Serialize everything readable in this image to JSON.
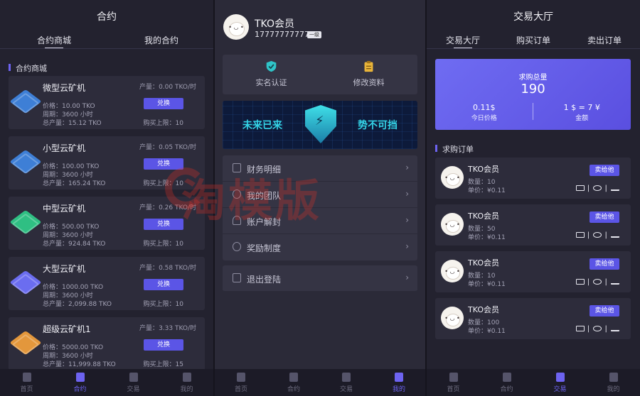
{
  "contracts": {
    "title": "合约",
    "tabs": [
      "合约商城",
      "我的合约"
    ],
    "section": "合约商城",
    "price_label": "价格：",
    "period_label": "周期：",
    "total_label": "总产量：",
    "yield_label": "产量：",
    "limit_label": "购买上限：",
    "exchange_label": "兑换",
    "machines": [
      {
        "name": "微型云矿机",
        "yield": "0.00 TKO/时",
        "price": "10.00 TKO",
        "period": "3600 小时",
        "total": "15.12 TKO",
        "limit": "10",
        "color": "#3e7fd6"
      },
      {
        "name": "小型云矿机",
        "yield": "0.05 TKO/时",
        "price": "100.00 TKO",
        "period": "3600 小时",
        "total": "165.24 TKO",
        "limit": "10",
        "color": "#3e7fd6"
      },
      {
        "name": "中型云矿机",
        "yield": "0.26 TKO/时",
        "price": "500.00 TKO",
        "period": "3600 小时",
        "total": "924.84 TKO",
        "limit": "10",
        "color": "#2fbf83"
      },
      {
        "name": "大型云矿机",
        "yield": "0.58 TKO/时",
        "price": "1000.00 TKO",
        "period": "3600 小时",
        "total": "2,099.88 TKO",
        "limit": "10",
        "color": "#6b6df0"
      },
      {
        "name": "超级云矿机1",
        "yield": "3.33 TKO/时",
        "price": "5000.00 TKO",
        "period": "3600 小时",
        "total": "11,999.88 TKO",
        "limit": "15",
        "color": "#e3973c"
      }
    ]
  },
  "nav": [
    "首页",
    "合约",
    "交易",
    "我的"
  ],
  "profile": {
    "name": "TKO会员",
    "phone": "17777777777",
    "level": "一级",
    "quick": [
      "实名认证",
      "修改资料"
    ],
    "banner_left": "未来已来",
    "banner_right": "势不可挡",
    "menu": [
      "财务明细",
      "我的团队",
      "账户解封",
      "奖励制度"
    ],
    "logout": "退出登陆",
    "chevron": "›"
  },
  "market": {
    "title": "交易大厅",
    "tabs": [
      "交易大厅",
      "购买订单",
      "卖出订单"
    ],
    "total_label": "求购总量",
    "total_value": "190",
    "price_value": "0.11$",
    "price_label": "今日价格",
    "rate_value": "1 $ = 7 ¥",
    "rate_label": "金额",
    "section": "求购订单",
    "qty_label": "数量：",
    "unit_label": "单价：",
    "sell_label": "卖给他",
    "orders": [
      {
        "name": "TKO会员",
        "qty": "10",
        "unit": "¥0.11"
      },
      {
        "name": "TKO会员",
        "qty": "50",
        "unit": "¥0.11"
      },
      {
        "name": "TKO会员",
        "qty": "10",
        "unit": "¥0.11"
      },
      {
        "name": "TKO会员",
        "qty": "100",
        "unit": "¥0.11"
      }
    ]
  },
  "watermark": "淘模版",
  "colors": {
    "accent": "#5b55e6",
    "bg": "#23222f",
    "card": "#2d2c3b"
  }
}
